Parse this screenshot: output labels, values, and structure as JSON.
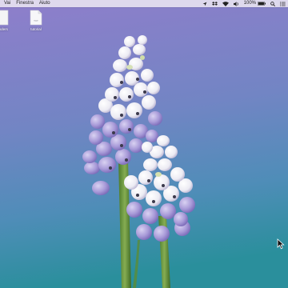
{
  "menubar": {
    "items": [
      "Vai",
      "Finestra",
      "Aiuto"
    ],
    "status": {
      "icons": [
        "location-arrow-icon",
        "dropbox-icon",
        "wifi-icon",
        "volume-icon"
      ],
      "battery_text": "100%",
      "battery_icon": "battery-icon",
      "search_icon": "spotlight-search-icon",
      "list_icon": "notification-center-icon"
    }
  },
  "desktop": {
    "icons": [
      {
        "label": "enders",
        "icon": "folder-icon"
      },
      {
        "label": "tutorial",
        "icon": "document-icon",
        "badge": "TXT"
      }
    ]
  },
  "colors": {
    "wallpaper_top": "#8a7ec9",
    "wallpaper_mid": "#6c86c2",
    "wallpaper_bottom": "#2f8fa0",
    "flower_lavender": "#a79ad6",
    "flower_white": "#f3f3f6",
    "stem": "#5f8a3a"
  }
}
